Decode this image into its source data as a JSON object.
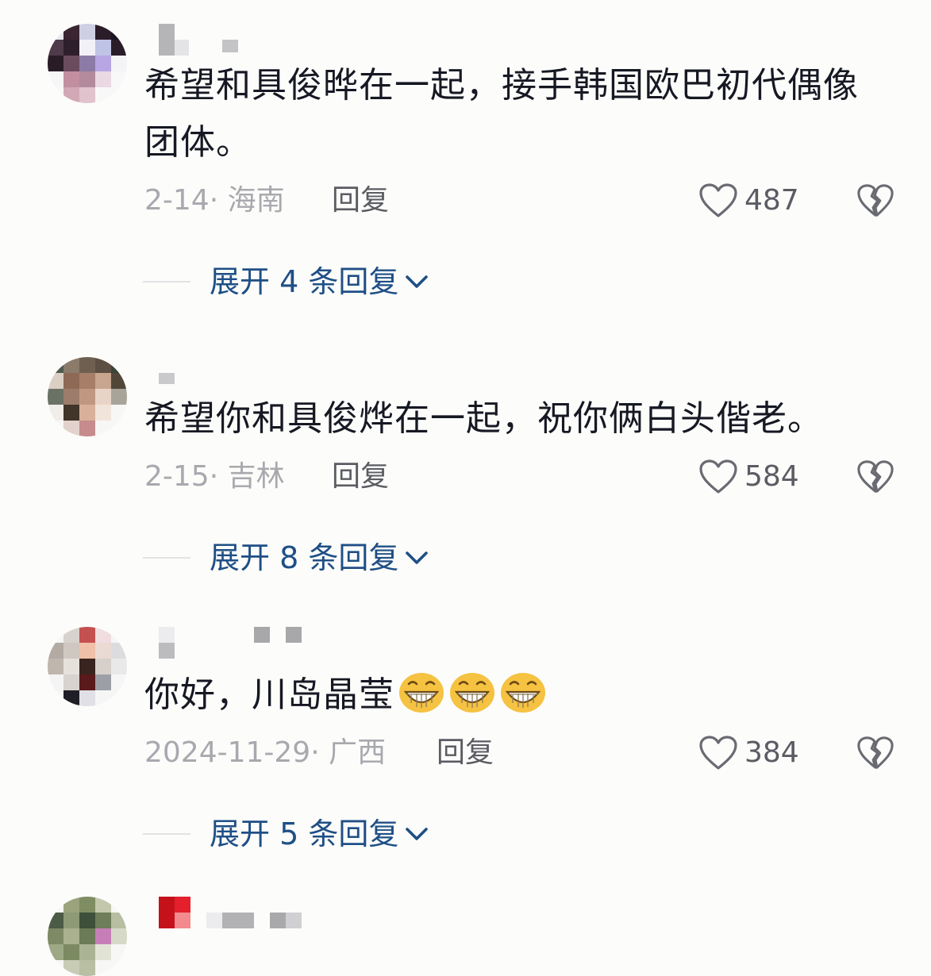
{
  "comments": [
    {
      "text": "希望和具俊晔在一起，接手韩国欧巴初代偶像团体。",
      "date": "2-14· 海南",
      "reply_label": "回复",
      "likes": "487",
      "expand_label": "展开 4 条回复"
    },
    {
      "text": "希望你和具俊烨在一起，祝你俩白头偕老。",
      "date": "2-15· 吉林",
      "reply_label": "回复",
      "likes": "584",
      "expand_label": "展开 8 条回复"
    },
    {
      "text": "你好，川岛晶莹",
      "emoji_count": 3,
      "emoji_icon": "grinning-face-icon",
      "date": "2024-11-29· 广西",
      "reply_label": "回复",
      "likes": "384",
      "expand_label": "展开 5 条回复"
    }
  ],
  "icons": {
    "like": "heart-outline-icon",
    "dislike": "broken-heart-icon",
    "expand": "chevron-down-icon"
  },
  "colors": {
    "text": "#161823",
    "meta": "#a8a9ae",
    "reply": "#5b5c63",
    "expand_link": "#1f4f86",
    "background": "#fcfcfa"
  }
}
